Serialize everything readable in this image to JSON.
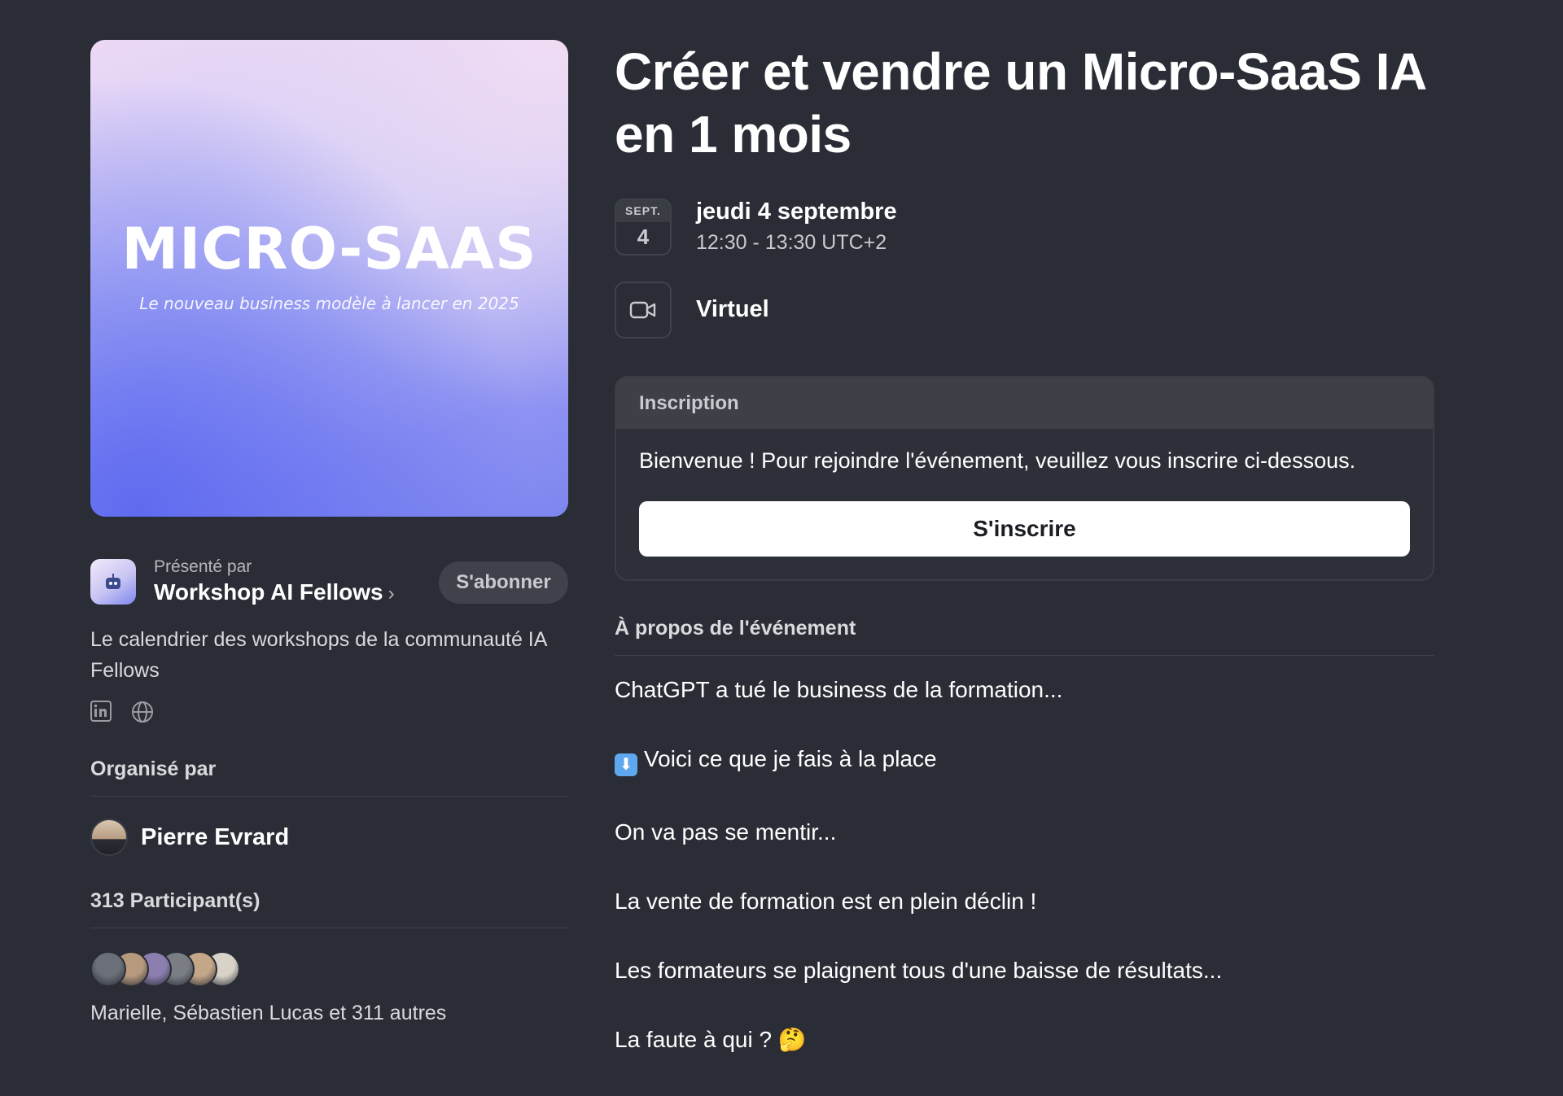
{
  "event": {
    "title": "Créer et vendre un Micro-SaaS IA en 1 mois",
    "cover": {
      "title": "MICRO-SAAS",
      "subtitle": "Le nouveau business modèle à lancer en 2025"
    },
    "date": {
      "month": "SEPT.",
      "day": "4",
      "main": "jeudi 4 septembre",
      "time": "12:30 - 13:30 UTC+2"
    },
    "venue": {
      "icon": "video-camera-icon",
      "label": "Virtuel"
    }
  },
  "presenter": {
    "label": "Présenté par",
    "name": "Workshop AI Fellows",
    "chevron": "›",
    "subscribe_label": "S'abonner",
    "description": "Le calendrier des workshops de la communauté IA Fellows",
    "socials": [
      "linkedin-icon",
      "globe-icon"
    ]
  },
  "organizer": {
    "heading": "Organisé par",
    "name": "Pierre Evrard"
  },
  "participants": {
    "heading": "313 Participant(s)",
    "summary": "Marielle, Sébastien Lucas et 311 autres",
    "avatar_colors": [
      "#6b6f78",
      "#b79a7e",
      "#8c7fb0",
      "#7a7d84",
      "#c4a688",
      "#d8d2c8"
    ]
  },
  "registration": {
    "heading": "Inscription",
    "text": "Bienvenue ! Pour rejoindre l'événement, veuillez vous inscrire ci-dessous.",
    "button_label": "S'inscrire"
  },
  "about": {
    "heading": "À propos de l'événement",
    "lines": [
      "ChatGPT a tué le business de la formation...",
      "Voici ce que je fais à la place",
      "On va pas se mentir...",
      "La vente de formation est en plein déclin !",
      "Les formateurs se plaignent tous d'une baisse de résultats...",
      "La faute à qui ? 🤔"
    ],
    "emoji": "⬇"
  },
  "colors": {
    "background": "#2a2d35",
    "card_header": "#3d4047",
    "button_bg": "#ffffff",
    "muted_text": "#c9cbd0"
  }
}
